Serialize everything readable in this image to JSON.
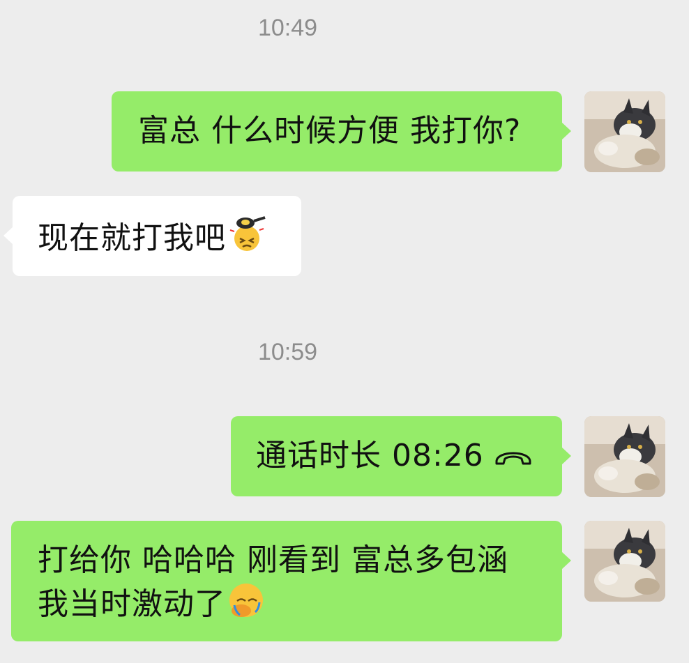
{
  "chat": {
    "timestamps": [
      "10:49",
      "10:59"
    ],
    "messages": [
      {
        "sender": "me",
        "text": "富总 什么时候方便 我打你?"
      },
      {
        "sender": "other",
        "text": "现在就打我吧",
        "emoji": "frying-pan-hit-emoji"
      },
      {
        "sender": "me",
        "type": "voice-call",
        "text": "通话时长 08:26",
        "icon": "phone-hangup-icon"
      },
      {
        "sender": "me",
        "text_line1": "打给你 哈哈哈 刚看到 富总多包涵",
        "text_line2": "我当时激动了",
        "emoji": "facepalm-emoji"
      }
    ]
  },
  "colors": {
    "background": "#ededed",
    "my_bubble": "#95ec69",
    "other_bubble": "#ffffff",
    "timestamp": "#8c8c8c"
  }
}
